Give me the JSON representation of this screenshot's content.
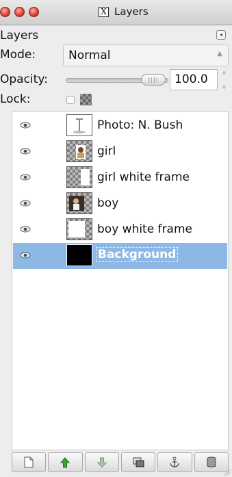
{
  "window": {
    "title": "Layers"
  },
  "panel": {
    "tab_label": "Layers"
  },
  "mode": {
    "label": "Mode:",
    "value": "Normal"
  },
  "opacity": {
    "label": "Opacity:",
    "value": "100.0",
    "slider_fraction": 1.0
  },
  "lock": {
    "label": "Lock:",
    "pixels_locked": false,
    "alpha_locked": false
  },
  "layers": [
    {
      "name": "Photo: N. Bush",
      "visible": true,
      "selected": false,
      "thumbnail": "text-layer"
    },
    {
      "name": "girl",
      "visible": true,
      "selected": false,
      "thumbnail": "photo-on-transparent"
    },
    {
      "name": "girl white frame",
      "visible": true,
      "selected": false,
      "thumbnail": "white-frame-on-transparent"
    },
    {
      "name": "boy",
      "visible": true,
      "selected": false,
      "thumbnail": "photo-on-transparent"
    },
    {
      "name": "boy white frame",
      "visible": true,
      "selected": false,
      "thumbnail": "white-frame-on-transparent"
    },
    {
      "name": "Background",
      "visible": true,
      "selected": true,
      "thumbnail": "black-fill"
    }
  ],
  "toolbar": {
    "buttons": [
      {
        "icon": "new-layer-icon"
      },
      {
        "icon": "raise-layer-icon"
      },
      {
        "icon": "lower-layer-icon"
      },
      {
        "icon": "duplicate-layer-icon"
      },
      {
        "icon": "anchor-layer-icon"
      },
      {
        "icon": "delete-layer-icon"
      }
    ]
  },
  "colors": {
    "selection": "#8db8e6",
    "raise_arrow": "#3aa23a"
  }
}
